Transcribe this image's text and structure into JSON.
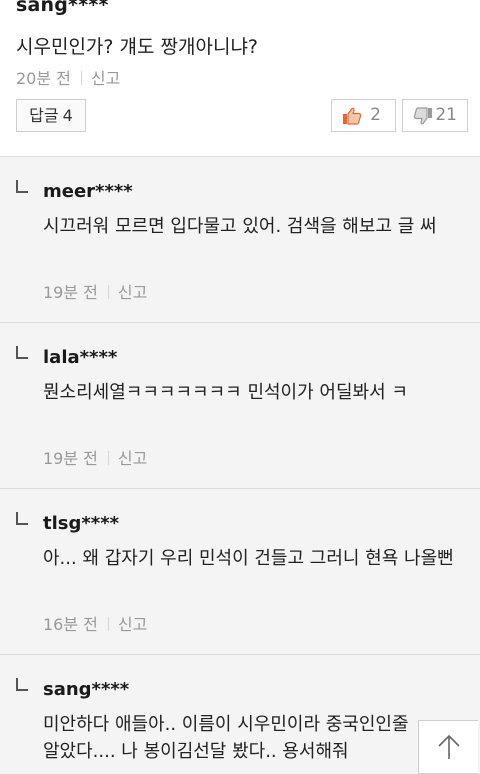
{
  "parent": {
    "username": "sang****",
    "text": "시우민인가? 걔도 짱개아니냐?",
    "time": "20분 전",
    "report": "신고",
    "reply_label": "답글",
    "reply_count": "4",
    "likes": "2",
    "dislikes": "21",
    "icons": {
      "like": "thumbs-up-icon",
      "dislike": "thumbs-down-icon"
    }
  },
  "replies": [
    {
      "username": "meer****",
      "text": "시끄러워 모르면 입다물고 있어. 검색을 해보고 글 써",
      "time": "19분 전",
      "report": "신고"
    },
    {
      "username": "lala****",
      "text": "뭔소리세열ㅋㅋㅋㅋㅋㅋㅋ 민석이가 어딜봐서 ㅋ",
      "time": "19분 전",
      "report": "신고"
    },
    {
      "username": "tlsg****",
      "text": "아... 왜 갑자기 우리 민석이 건들고 그러니 현욕 나올뻔",
      "time": "16분 전",
      "report": "신고"
    },
    {
      "username": "sang****",
      "text": "미안하다 애들아.. 이름이 시우민이라 중국인인줄 알았다.... 나 봉이김선달 봤다.. 용서해줘"
    }
  ],
  "colors": {
    "accent_like": "#e8673a",
    "accent_dislike": "#9a9a9a",
    "reply_bg": "#f4f4f4"
  }
}
